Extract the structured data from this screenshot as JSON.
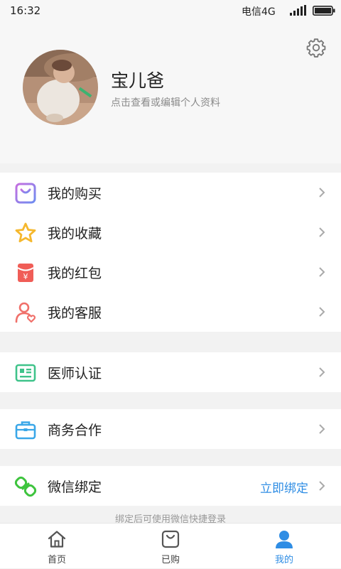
{
  "status_bar": {
    "time": "16:32",
    "carrier": "电信4G"
  },
  "profile": {
    "name": "宝儿爸",
    "subtitle": "点击查看或编辑个人资料"
  },
  "menu_groups": [
    {
      "items": [
        {
          "label": "我的购买",
          "icon": "shopping-bag-icon",
          "color": "#9a7ee8"
        },
        {
          "label": "我的收藏",
          "icon": "star-icon",
          "color": "#f5b82e"
        },
        {
          "label": "我的红包",
          "icon": "red-packet-icon",
          "color": "#f05d57"
        },
        {
          "label": "我的客服",
          "icon": "customer-service-icon",
          "color": "#f0706a"
        }
      ]
    },
    {
      "items": [
        {
          "label": "医师认证",
          "icon": "id-card-icon",
          "color": "#3fc38a"
        }
      ]
    },
    {
      "items": [
        {
          "label": "商务合作",
          "icon": "briefcase-icon",
          "color": "#3aa7e8"
        }
      ]
    },
    {
      "items": [
        {
          "label": "微信绑定",
          "icon": "link-icon",
          "color": "#3ec43e",
          "action": "立即绑定"
        }
      ]
    }
  ],
  "footer_note": "绑定后可使用微信快捷登录",
  "tabs": [
    {
      "label": "首页",
      "icon": "home-icon",
      "active": false
    },
    {
      "label": "已购",
      "icon": "bag-icon",
      "active": false
    },
    {
      "label": "我的",
      "icon": "user-icon",
      "active": true
    }
  ],
  "colors": {
    "accent": "#2f8de4",
    "tab_inactive": "#444444"
  }
}
